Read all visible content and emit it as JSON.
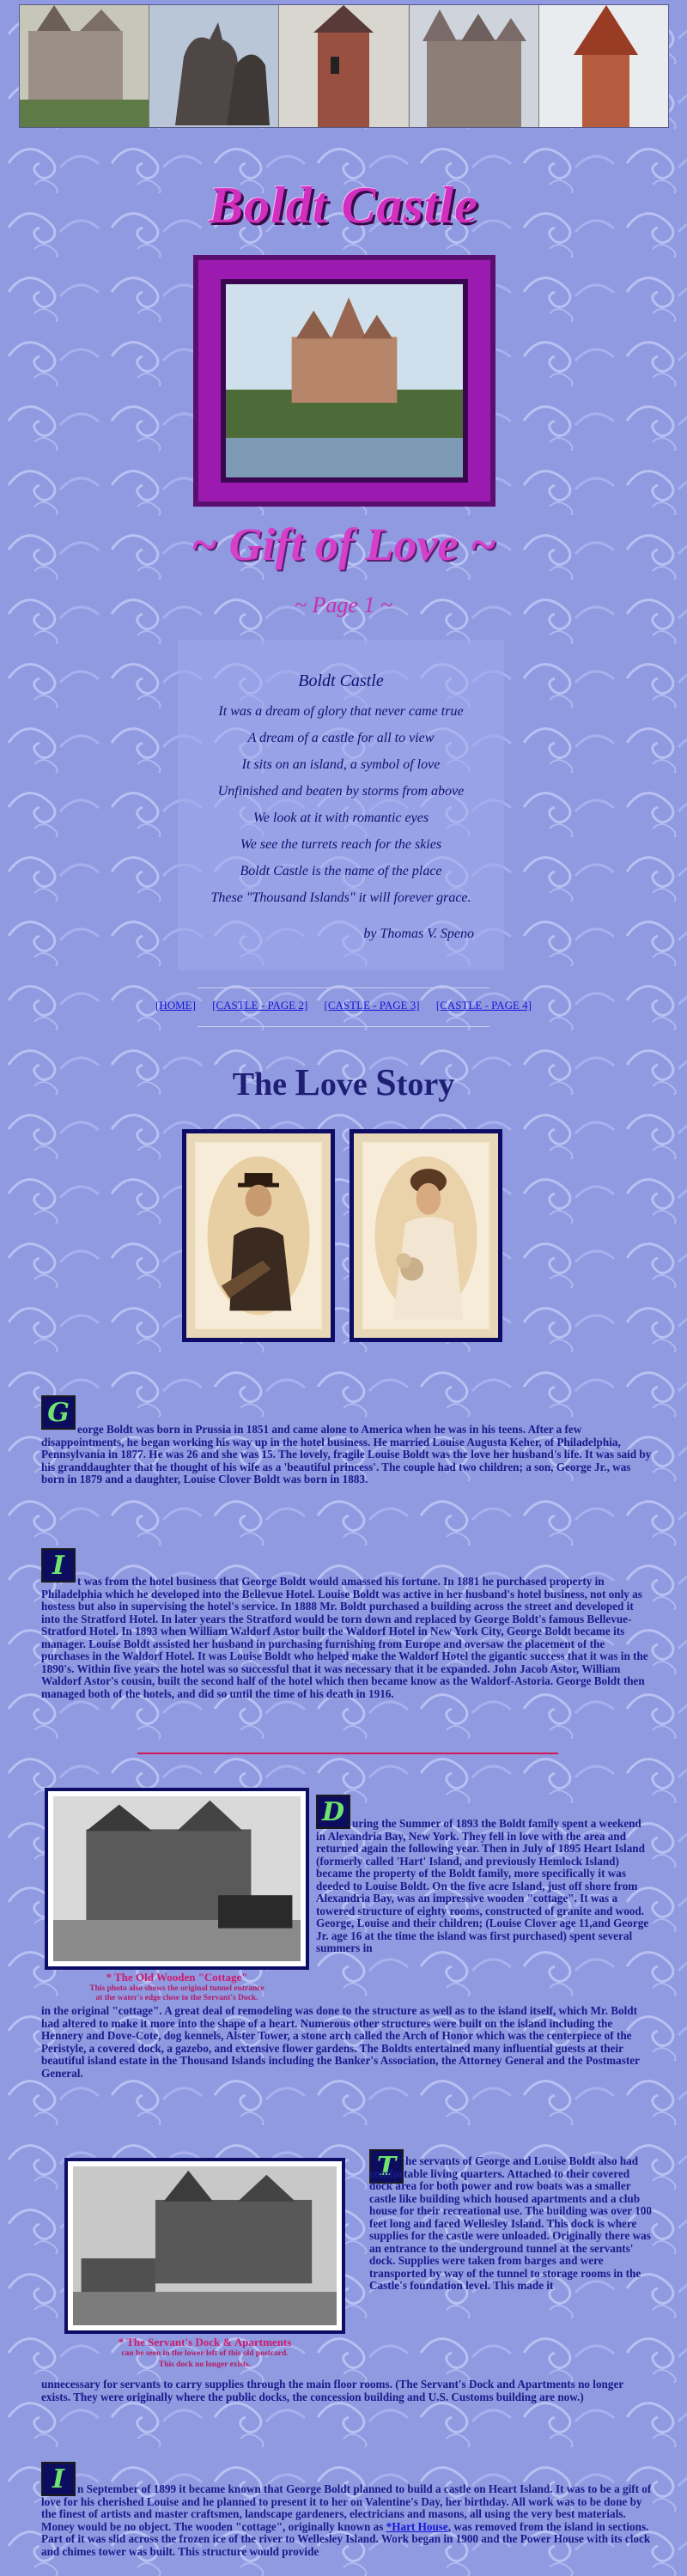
{
  "banner": {
    "photos": [
      "castle-photo-1",
      "deer-sculpture-photo",
      "alster-tower-photo",
      "castle-photo-2",
      "dove-cote-photo"
    ]
  },
  "header": {
    "title": "Boldt Castle",
    "subtitle": "~ Gift of Love ~",
    "page_indicator": "~ Page 1 ~"
  },
  "poem": {
    "title": "Boldt Castle",
    "lines": [
      "It was a dream of glory that never came true",
      "A dream of a castle for all to view",
      "It sits on an island, a symbol of love",
      "Unfinished and beaten by storms from above",
      "We look at it with romantic eyes",
      "We see the turrets reach for the skies",
      "Boldt Castle is the name of the place",
      "These \"Thousand Islands\" it will forever grace."
    ],
    "author": "by Thomas V. Speno"
  },
  "nav": {
    "home": "[HOME]",
    "page2": "[CASTLE - PAGE 2]",
    "page3": "[CASTLE - PAGE 3]",
    "page4": "[CASTLE - PAGE 4]"
  },
  "love_story": {
    "title_the": "The ",
    "title_L": "L",
    "title_ove": "ove ",
    "title_S": "S",
    "title_tory": "tory"
  },
  "sections": {
    "p1": {
      "cap": "G",
      "text": "eorge Boldt was born in Prussia in 1851 and came alone to America when he was in his teens. After a few disappointments, he began working his way up in the hotel business. He married Louise Augusta Keher, of Philadelphia, Pennsylvania in 1877.  He was 26 and she was 15.  The lovely, fragile Louise Boldt was the love her husband's life.  It was said by his granddaughter that he thought of his wife as a 'beautiful princess'. The couple had two children; a son, George Jr., was born in 1879 and a daughter, Louise Clover Boldt was born in 1883."
    },
    "p2": {
      "cap": "I",
      "text": "t was from the hotel business that George Boldt would amassed his fortune.  In 1881 he purchased property in Philadelphia which he developed into the Bellevue Hotel.  Louise Boldt was active in her husband's hotel business, not only as hostess but also in supervising the hotel's service.  In 1888 Mr. Boldt purchased a building across the street and developed it into the Stratford Hotel.  In later years the Stratford would be torn down and replaced by George Boldt's famous Bellevue-Stratford Hotel.  In 1893 when William Waldorf Astor built the Waldorf Hotel in New York City, George Boldt became its manager.  Louise Boldt assisted her husband in purchasing furnishing from Europe and oversaw the placement of the purchases in the Waldorf Hotel.  It was Louise Boldt who helped make the Waldorf Hotel the gigantic success that it was in the 1890's.  Within five years the hotel was so successful that it was necessary that it be expanded.  John Jacob Astor, William Waldorf Astor's cousin, built the second half of the hotel which then became know as the Waldorf-Astoria. George Boldt then managed both of the hotels, and did so until the time of his death in 1916."
    },
    "p3": {
      "cap": "D",
      "text_right": "uring the Summer of 1893 the Boldt family spent a weekend in Alexandria Bay, New York.  They fell in love with the area and returned again the following year.  Then in July of 1895 Heart Island (formerly called 'Hart' Island, and previously Hemlock Island) became the property of the Boldt family, more specifically it was deeded to Louise Boldt.  On the five acre Island, just off shore from Alexandria Bay, was an impressive wooden \"cottage\".  It was a towered structure of eighty rooms, constructed of granite and wood.  George, Louise and their children; (Louise Clover age 11,and George Jr. age 16 at the time the island was first purchased) spent several summers in",
      "text_full": "in the original \"cottage\".  A great deal of remodeling was done to the structure  as well as to the island itself, which Mr. Boldt had altered to make it more into the shape of a heart.  Numerous other structures were built on the island including the Hennery and Dove-Cote, dog kennels, Alster Tower, a stone arch called the Arch of Honor which was the centerpiece of the Peristyle, a covered dock, a gazebo, and extensive flower gardens.  The Boldts entertained many influential guests at their beautiful island estate in the Thousand Islands including the Banker's Association, the Attorney General and the Postmaster General.",
      "caption": "* The Old Wooden \"Cottage\"",
      "caption_sub1": "This photo also shows the original tunnel entrance",
      "caption_sub2": "at the water's edge close to the Servant's Dock."
    },
    "p4": {
      "cap": "T",
      "text_right": "he servants of George and Louise Boldt  also had comfortable living quarters. Attached to their covered dock area for both power and row boats was a smaller castle like building which housed apartments and a club house for their recreational use.  The building was over 100 feet long and faced Wellesley Island.  This dock is where supplies for the castle were unloaded.  Originally there was an entrance to the underground tunnel at the servants' dock.  Supplies were taken from barges and were transported by way of the tunnel to storage rooms in the Castle's foundation level.  This made it",
      "text_full": "unnecessary for servants to carry supplies through the main floor rooms.  (The Servant's Dock and Apartments no longer exists.  They were originally  where the public docks, the concession building and U.S. Customs building are now.)",
      "caption": "* The Servant's Dock & Apartments",
      "caption_sub1": "can be seen in the lower left of this old postcard.",
      "caption_sub2": "This dock no longer exists."
    },
    "p5": {
      "cap": "I",
      "text_a": "n September of 1899 it became known that George Boldt planned to build a castle on Heart Island.  It was to be a gift of love for his cherished Louise and he planned to present it to her on Valentine's Day, her birthday.  All work was to be done by the finest of artists and master craftsmen, landscape gardeners, electricians and masons, all using the very best materials.  Money would be no object.  The wooden \"cottage\", originally known as ",
      "link": "*Hart House",
      "text_b": ", was removed from the island in sections.  Part of it was slid across the frozen ice of the river to Wellesley Island.  Work began in 1900 and the Power House with its clock and chimes tower was built.  This structure would provide"
    }
  },
  "colors": {
    "background": "#8f9ae0",
    "title_pink": "#d02fbf",
    "text_navy": "#1a1a8a",
    "link": "#1515d8",
    "caption_red": "#cf1a6e"
  }
}
